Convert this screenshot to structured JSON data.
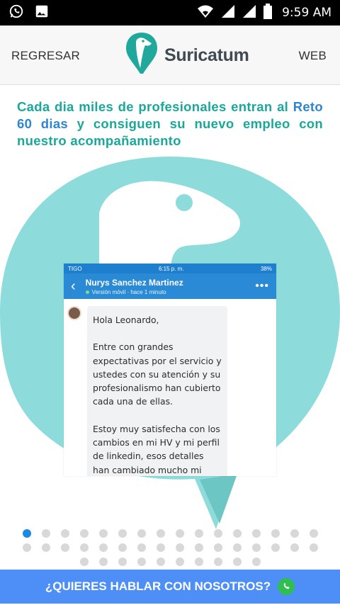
{
  "status_bar": {
    "time": "9:59 AM",
    "left_icons": [
      "whatsapp-icon",
      "image-icon"
    ],
    "right_icons": [
      "wifi-icon",
      "signal-icon",
      "signal-icon",
      "battery-icon"
    ]
  },
  "header": {
    "back_label": "REGRESAR",
    "brand_name": "Suricatum",
    "web_label": "WEB"
  },
  "main": {
    "headline_part1": "Cada dia miles de profesionales entran al ",
    "headline_accent": "Reto 60 dias",
    "headline_part2": " y consiguen su nuevo empleo con nuestro acompañamiento",
    "colors": {
      "teal": "#19a89a",
      "accent_blue": "#2f86d0",
      "shape": "#8ddcdb"
    }
  },
  "testimonial": {
    "carrier": "TIGO",
    "phone_time": "6:15 p. m.",
    "battery": "38%",
    "contact_name": "Nurys Sanchez Martinez",
    "contact_status": "Versión móvil · hace 1 minuto",
    "greeting": "Hola Leonardo,",
    "paragraph1": "Entre con grandes expectativas por el servicio y ustedes con su atención y su profesionalismo han cubierto cada una de ellas.",
    "paragraph2": "Estoy muy satisfecha con los cambios en mi HV y mi perfil de linkedin, esos detalles han cambiado mucho mi forma de mostrar mis fortalezas y"
  },
  "pager": {
    "active_index": 0,
    "row_counts": [
      16,
      16,
      10
    ]
  },
  "cta": {
    "label": "¿QUIERES HABLAR CON NOSOTROS?",
    "icon": "whatsapp-icon",
    "color": "#4e8ef7"
  }
}
